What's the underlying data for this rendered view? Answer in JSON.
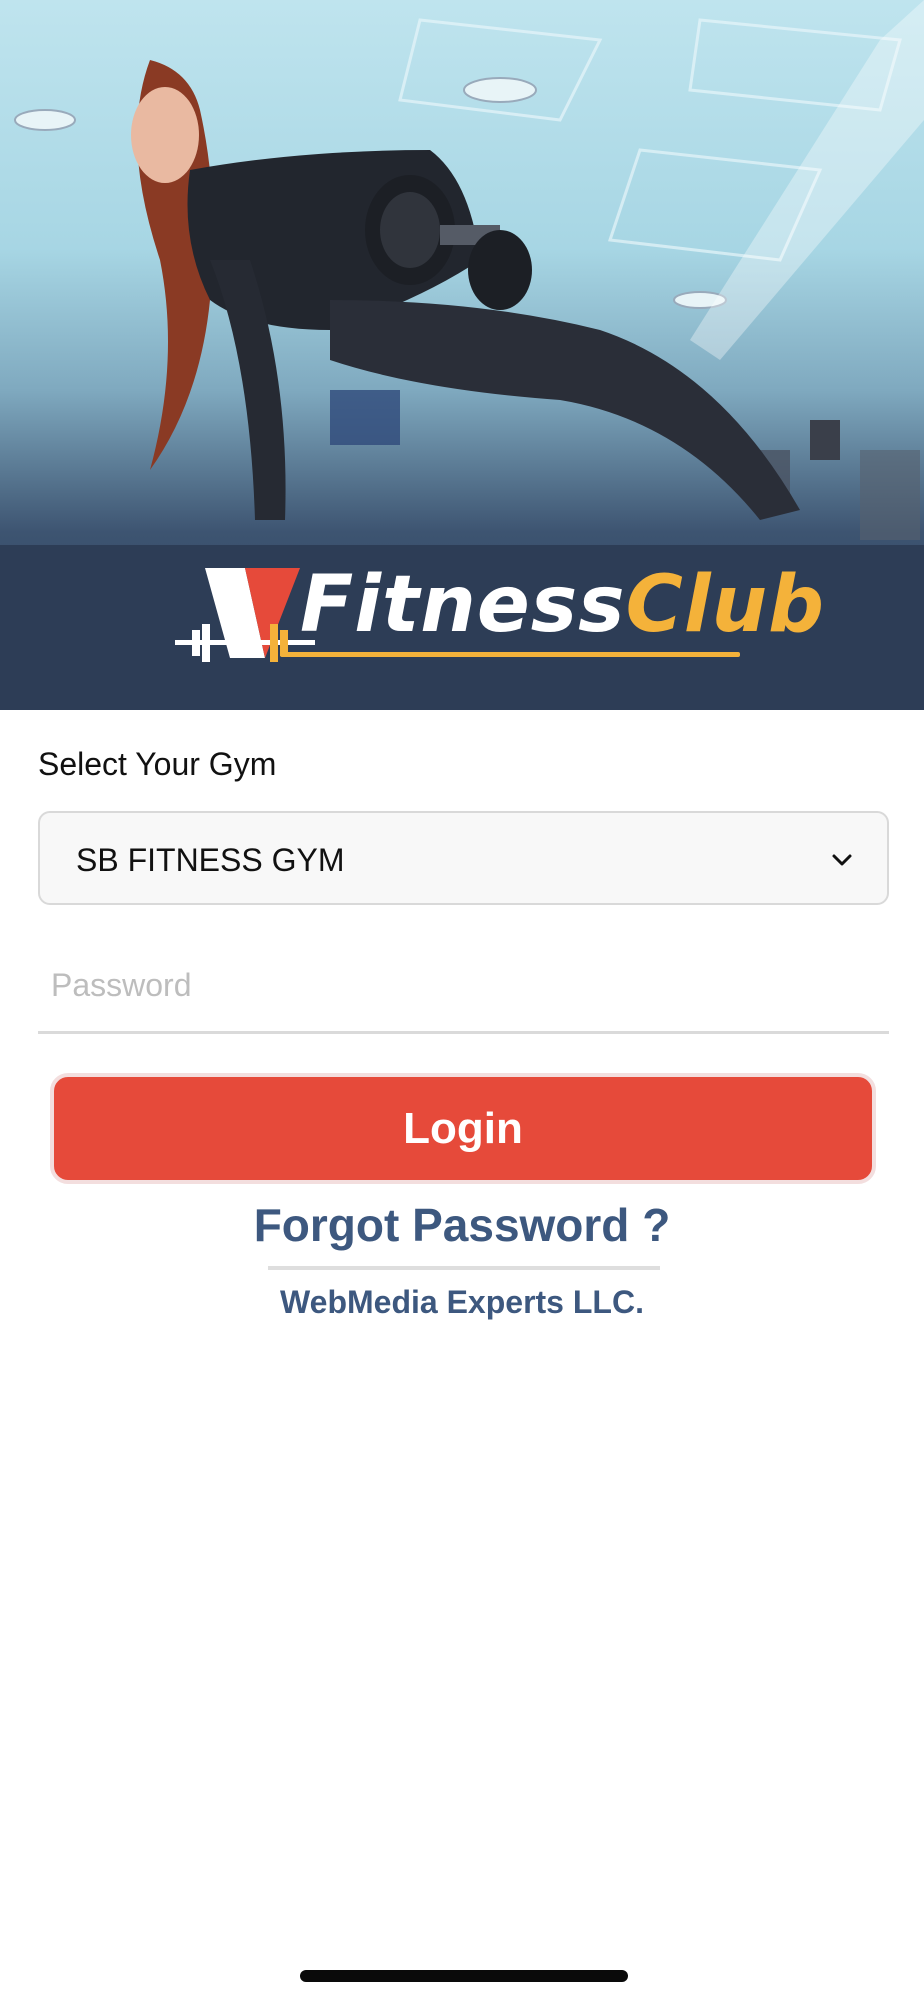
{
  "hero": {
    "logo_text_1": "Fitness",
    "logo_text_2": "Club",
    "logo_accent": "#f4b23a",
    "logo_red": "#e64a3a"
  },
  "form": {
    "gym_label": "Select Your Gym",
    "gym_selected": "SB FITNESS GYM",
    "password_placeholder": "Password",
    "login_label": "Login",
    "forgot_label": "Forgot Password ?"
  },
  "footer": {
    "company": "WebMedia Experts LLC."
  },
  "colors": {
    "primary_button": "#e64a3a",
    "link": "#3d587f"
  }
}
